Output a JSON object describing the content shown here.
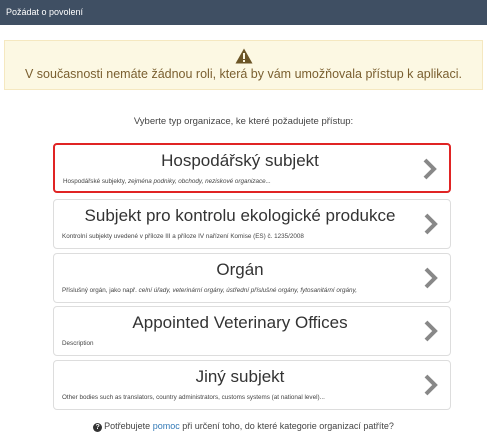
{
  "window": {
    "title": "Požádat o povolení"
  },
  "warning": {
    "icon": "warning-triangle-icon",
    "message": "V současnosti nemáte žádnou roli, která by vám umožňovala přístup k aplikaci."
  },
  "prompt": "Vyberte typ organizace, ke které požadujete přístup:",
  "options": [
    {
      "title": "Hospodářský subjekt",
      "desc_prefix": "Hospodářské subjekty, ",
      "desc_italic": "zejména podniky, obchody, neziskové organizace...",
      "selected": true
    },
    {
      "title": "Subjekt pro kontrolu ekologické produkce",
      "desc_prefix": "Kontrolní subjekty uvedené v příloze III a příloze IV nařízení Komise (ES) č. 1235/2008",
      "desc_italic": "",
      "selected": false
    },
    {
      "title": "Orgán",
      "desc_prefix": "Příslušný orgán, jako např. ",
      "desc_italic": "celní úřady, veterinární orgány, ústřední příslušné orgány, fytosanitární orgány,",
      "selected": false
    },
    {
      "title": "Appointed Veterinary Offices",
      "desc_prefix": "Description",
      "desc_italic": "",
      "selected": false
    },
    {
      "title": "Jiný subjekt",
      "desc_prefix": "Other bodies such as translators, country administrators, customs systems (at national level)...",
      "desc_italic": "",
      "selected": false
    }
  ],
  "help": {
    "icon": "question-circle-icon",
    "before": "Potřebujete ",
    "link": "pomoc",
    "after": " při určení toho, do které kategorie organizací patříte?"
  },
  "colors": {
    "titlebar": "#3f4f63",
    "warning_bg": "#fcf8e3",
    "selected_border": "#e02424",
    "link": "#337ab7"
  }
}
